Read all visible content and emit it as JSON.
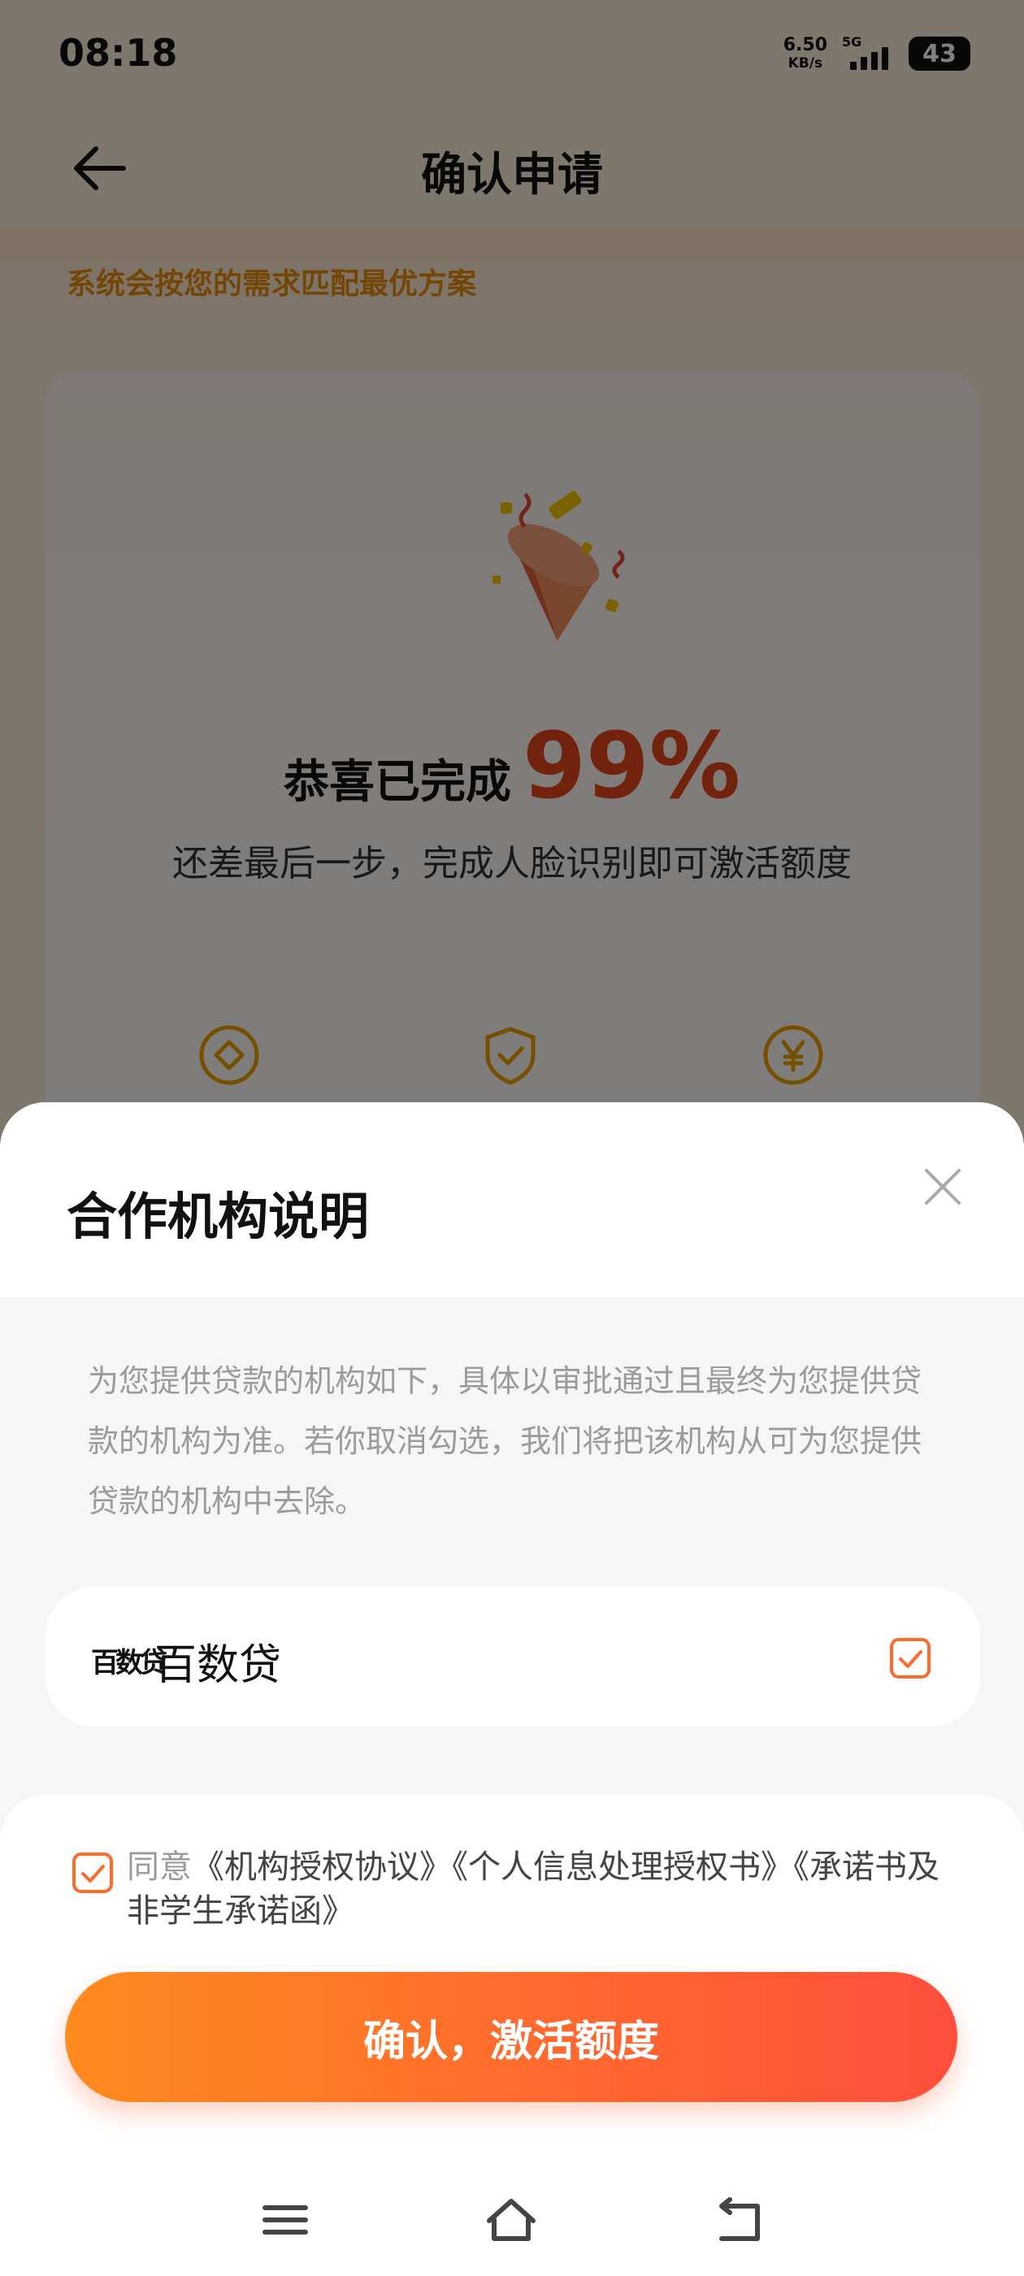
{
  "status_bar": {
    "time": "08:18",
    "net_speed_value": "6.50",
    "net_speed_unit": "KB/s",
    "network_type": "5G",
    "battery": "43"
  },
  "header": {
    "title": "确认申请"
  },
  "hint": {
    "text": "系统会按您的需求匹配最优方案"
  },
  "main_card": {
    "congrats_label": "恭喜已完成",
    "progress_percent": "99%",
    "subtitle": "还差最后一步，完成人脸识别即可激活额度"
  },
  "sheet": {
    "title": "合作机构说明",
    "description": "为您提供贷款的机构如下，具体以审批通过且最终为您提供贷款的机构为准。若你取消勾选，我们将把该机构从可为您提供贷款的机构中去除。",
    "institution": {
      "logo_text": "百数贷",
      "name": "百数贷",
      "checked": true
    },
    "agreement": {
      "prefix": "同意",
      "documents": "《机构授权协议》《个人信息处理授权书》《承诺书及非学生承诺函》",
      "checked": true
    },
    "confirm_label": "确认，激活额度"
  },
  "colors": {
    "accent": "#ff6a2b",
    "percent": "#e2461c",
    "hint": "#e98c0c",
    "icon_gold": "#e9a100"
  },
  "icons": [
    "back-arrow-icon",
    "party-popper-icon",
    "diamond-coin-icon",
    "shield-check-icon",
    "yen-coin-icon",
    "close-icon",
    "checkbox-checked-icon",
    "menu-icon",
    "home-icon",
    "back-icon"
  ]
}
